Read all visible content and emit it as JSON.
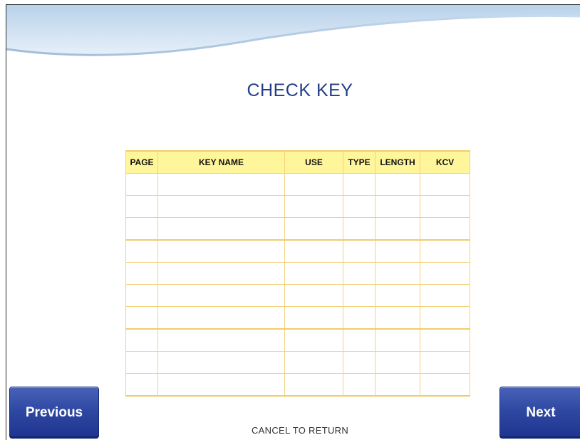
{
  "screen": {
    "title": "CHECK KEY",
    "footer_hint": "CANCEL TO RETURN"
  },
  "table": {
    "columns": [
      "PAGE",
      "KEY NAME",
      "USE",
      "TYPE",
      "LENGTH",
      "KCV"
    ],
    "rows": [
      [
        "",
        "",
        "",
        "",
        "",
        ""
      ],
      [
        "",
        "",
        "",
        "",
        "",
        ""
      ],
      [
        "",
        "",
        "",
        "",
        "",
        ""
      ],
      [
        "",
        "",
        "",
        "",
        "",
        ""
      ],
      [
        "",
        "",
        "",
        "",
        "",
        ""
      ],
      [
        "",
        "",
        "",
        "",
        "",
        ""
      ],
      [
        "",
        "",
        "",
        "",
        "",
        ""
      ],
      [
        "",
        "",
        "",
        "",
        "",
        ""
      ],
      [
        "",
        "",
        "",
        "",
        "",
        ""
      ],
      [
        "",
        "",
        "",
        "",
        "",
        ""
      ]
    ]
  },
  "buttons": {
    "previous_label": "Previous",
    "next_label": "Next"
  },
  "colors": {
    "title": "#243d88",
    "button": "#2f48a2",
    "table_header": "#fff59a",
    "table_border": "#f3d27e"
  }
}
